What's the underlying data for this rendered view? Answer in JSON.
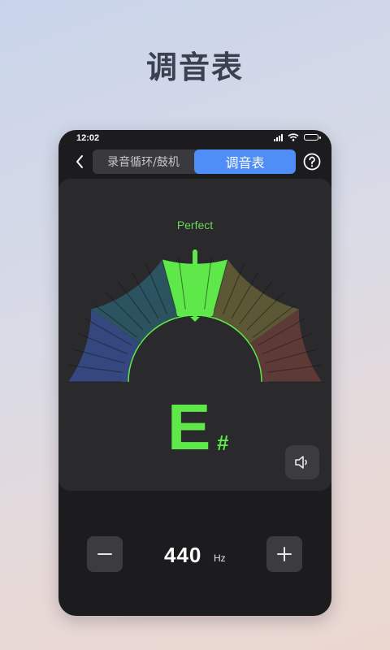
{
  "page": {
    "title": "调音表"
  },
  "status_bar": {
    "time": "12:02"
  },
  "nav": {
    "tabs": [
      {
        "label": "录音循环/鼓机",
        "active": false
      },
      {
        "label": "调音表",
        "active": true
      }
    ]
  },
  "tuner": {
    "status": "Perfect",
    "note": "E",
    "accidental": "#",
    "pitch_offset": 0,
    "colors": {
      "in_tune": "#5ee84a",
      "flat": "#3d5bbd",
      "sharp": "#c04a3a",
      "accent": "#4f8ef7"
    }
  },
  "reference": {
    "value": "440",
    "unit": "Hz"
  },
  "icons": [
    "back-icon",
    "help-icon",
    "speaker-icon",
    "minus-icon",
    "plus-icon"
  ]
}
